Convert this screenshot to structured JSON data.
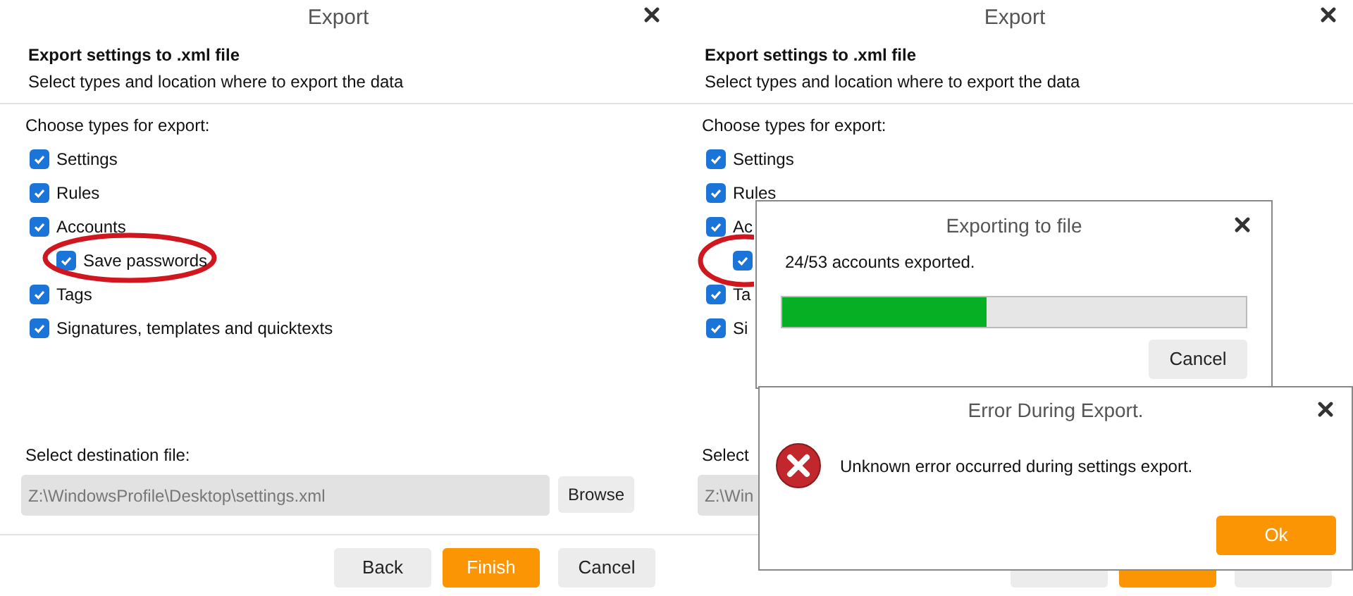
{
  "panels": [
    {
      "window": {
        "title": "Export"
      },
      "heading": "Export settings to .xml file",
      "subheading": "Select types and location where to export the data",
      "types_label": "Choose types for export:",
      "types": [
        {
          "label": "Settings",
          "checked": true
        },
        {
          "label": "Rules",
          "checked": true
        },
        {
          "label": "Accounts",
          "checked": true,
          "children": [
            {
              "label": "Save passwords",
              "checked": true,
              "circled": true
            }
          ]
        },
        {
          "label": "Tags",
          "checked": true
        },
        {
          "label": "Signatures, templates and quicktexts",
          "checked": true
        }
      ],
      "destination_label": "Select destination file:",
      "destination": {
        "value": "Z:\\WindowsProfile\\Desktop\\settings.xml"
      },
      "browse_button": "Browse",
      "buttons": [
        {
          "label": "Back",
          "primary": false
        },
        {
          "label": "Finish",
          "primary": true
        },
        {
          "label": "Cancel",
          "primary": false
        }
      ]
    },
    {
      "window": {
        "title": "Export"
      },
      "heading": "Export settings to .xml file",
      "subheading": "Select types and location where to export the data",
      "types_label": "Choose types for export:",
      "types": [
        {
          "label": "Settings",
          "checked": true
        },
        {
          "label": "Rules",
          "checked": true
        },
        {
          "label": "Ac",
          "checked": true,
          "children": [
            {
              "checked": true,
              "circled": true
            }
          ]
        },
        {
          "label": "Ta",
          "checked": true
        },
        {
          "label": "Si",
          "checked": true
        }
      ],
      "destination_label": "Select",
      "destination": {
        "value": "Z:\\Win"
      },
      "buttons": [
        {
          "primary": false
        },
        {
          "primary": true
        },
        {
          "primary": false
        }
      ],
      "dialogs": [
        {
          "kind": "progress",
          "title": "Exporting to file",
          "message": "24/53 accounts exported.",
          "level": 0.44,
          "buttons": [
            {
              "label": "Cancel",
              "primary": false
            }
          ]
        },
        {
          "kind": "error",
          "title": "Error During Export.",
          "message": "Unknown error occurred during settings export.",
          "buttons": [
            {
              "label": "Ok",
              "primary": true
            }
          ]
        }
      ]
    }
  ]
}
